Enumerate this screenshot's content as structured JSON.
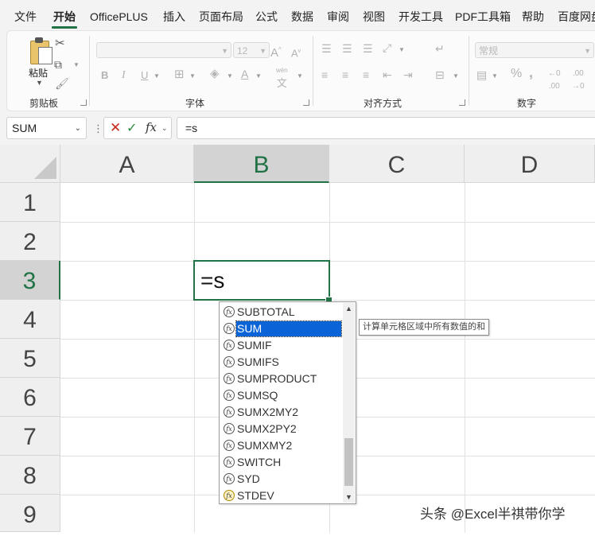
{
  "menu": {
    "items": [
      {
        "id": "file",
        "label": "文件"
      },
      {
        "id": "home",
        "label": "开始",
        "active": true
      },
      {
        "id": "officeplus",
        "label": "OfficePLUS"
      },
      {
        "id": "insert",
        "label": "插入"
      },
      {
        "id": "pagelayout",
        "label": "页面布局"
      },
      {
        "id": "formulas",
        "label": "公式"
      },
      {
        "id": "data",
        "label": "数据"
      },
      {
        "id": "review",
        "label": "审阅"
      },
      {
        "id": "view",
        "label": "视图"
      },
      {
        "id": "developer",
        "label": "开发工具"
      },
      {
        "id": "pdf",
        "label": "PDF工具箱"
      },
      {
        "id": "help",
        "label": "帮助"
      },
      {
        "id": "baidu",
        "label": "百度网盘"
      }
    ]
  },
  "ribbon": {
    "clipboard": {
      "paste_label": "粘贴",
      "group_label": "剪贴板"
    },
    "font": {
      "group_label": "字体",
      "font_name": "",
      "font_size": "12",
      "bold": "B",
      "italic": "I",
      "underline": "U",
      "wen": "wén",
      "wen_char": "文"
    },
    "alignment": {
      "group_label": "对齐方式"
    },
    "number": {
      "group_label": "数字",
      "format": "常规"
    }
  },
  "formula_bar": {
    "name_box": "SUM",
    "fx": "fx",
    "formula": "=s"
  },
  "grid": {
    "columns": [
      "A",
      "B",
      "C",
      "D"
    ],
    "rows": [
      "1",
      "2",
      "3",
      "4",
      "5",
      "6",
      "7",
      "8",
      "9"
    ],
    "active_cell": {
      "col": "B",
      "row": "3",
      "value": "=s"
    }
  },
  "autocomplete": {
    "items": [
      "SUBTOTAL",
      "SUM",
      "SUMIF",
      "SUMIFS",
      "SUMPRODUCT",
      "SUMSQ",
      "SUMX2MY2",
      "SUMX2PY2",
      "SUMXMY2",
      "SWITCH",
      "SYD",
      "STDEV"
    ],
    "selected": "SUM",
    "tooltip": "计算单元格区域中所有数值的和"
  },
  "watermark": "头条 @Excel半祺带你学",
  "colors": {
    "accent": "#217346",
    "selection": "#0a64d8"
  }
}
